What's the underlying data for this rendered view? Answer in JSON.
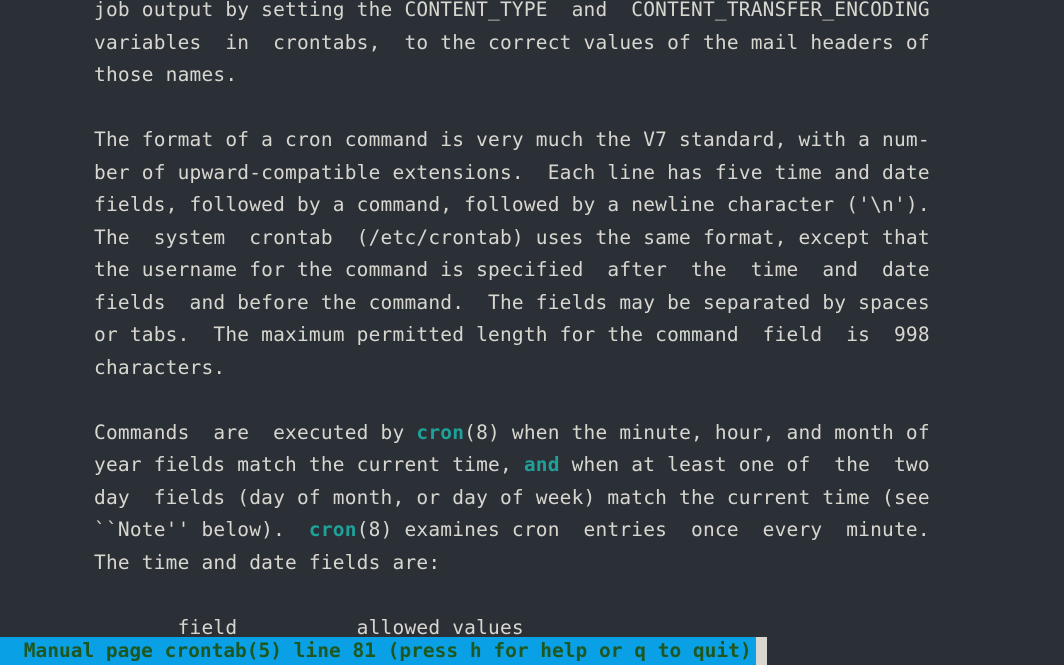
{
  "lines": [
    {
      "segments": [
        {
          "t": "job output by setting the CONTENT_TYPE  and  CONTENT_TRANSFER_ENCODING",
          "c": ""
        }
      ]
    },
    {
      "segments": [
        {
          "t": "variables  in  crontabs,  to the correct values of the mail headers of",
          "c": ""
        }
      ]
    },
    {
      "segments": [
        {
          "t": "those names.",
          "c": ""
        }
      ]
    },
    {
      "segments": [
        {
          "t": "",
          "c": ""
        }
      ]
    },
    {
      "segments": [
        {
          "t": "The format of a cron command is very much the V7 standard, with a num‐",
          "c": ""
        }
      ]
    },
    {
      "segments": [
        {
          "t": "ber of upward-compatible extensions.  Each line has five time and date",
          "c": ""
        }
      ]
    },
    {
      "segments": [
        {
          "t": "fields, followed by a command, followed by a newline character ('\\n').",
          "c": ""
        }
      ]
    },
    {
      "segments": [
        {
          "t": "The  system  crontab  (/etc/crontab) uses the same format, except that",
          "c": ""
        }
      ]
    },
    {
      "segments": [
        {
          "t": "the username for the command is specified  after  the  time  and  date",
          "c": ""
        }
      ]
    },
    {
      "segments": [
        {
          "t": "fields  and before the command.  The fields may be separated by spaces",
          "c": ""
        }
      ]
    },
    {
      "segments": [
        {
          "t": "or tabs.  The maximum permitted length for the command  field  is  998",
          "c": ""
        }
      ]
    },
    {
      "segments": [
        {
          "t": "characters.",
          "c": ""
        }
      ]
    },
    {
      "segments": [
        {
          "t": "",
          "c": ""
        }
      ]
    },
    {
      "segments": [
        {
          "t": "Commands  are  executed by ",
          "c": ""
        },
        {
          "t": "cron",
          "c": "bold cyan"
        },
        {
          "t": "(8) when the minute, hour, and month of",
          "c": ""
        }
      ]
    },
    {
      "segments": [
        {
          "t": "year fields match the current time, ",
          "c": ""
        },
        {
          "t": "and",
          "c": "bold cyan"
        },
        {
          "t": " when at least one of  the  two",
          "c": ""
        }
      ]
    },
    {
      "segments": [
        {
          "t": "day  fields (day of month, or day of week) match the current time (see",
          "c": ""
        }
      ]
    },
    {
      "segments": [
        {
          "t": "``Note'' below).  ",
          "c": ""
        },
        {
          "t": "cron",
          "c": "bold cyan"
        },
        {
          "t": "(8) examines cron  entries  once  every  minute.",
          "c": ""
        }
      ]
    },
    {
      "segments": [
        {
          "t": "The time and date fields are:",
          "c": ""
        }
      ]
    },
    {
      "segments": [
        {
          "t": "",
          "c": ""
        }
      ]
    },
    {
      "segments": [
        {
          "t": "       field          allowed values",
          "c": ""
        }
      ]
    }
  ],
  "status": " Manual page crontab(5) line 81 (press h for help or q to quit)"
}
